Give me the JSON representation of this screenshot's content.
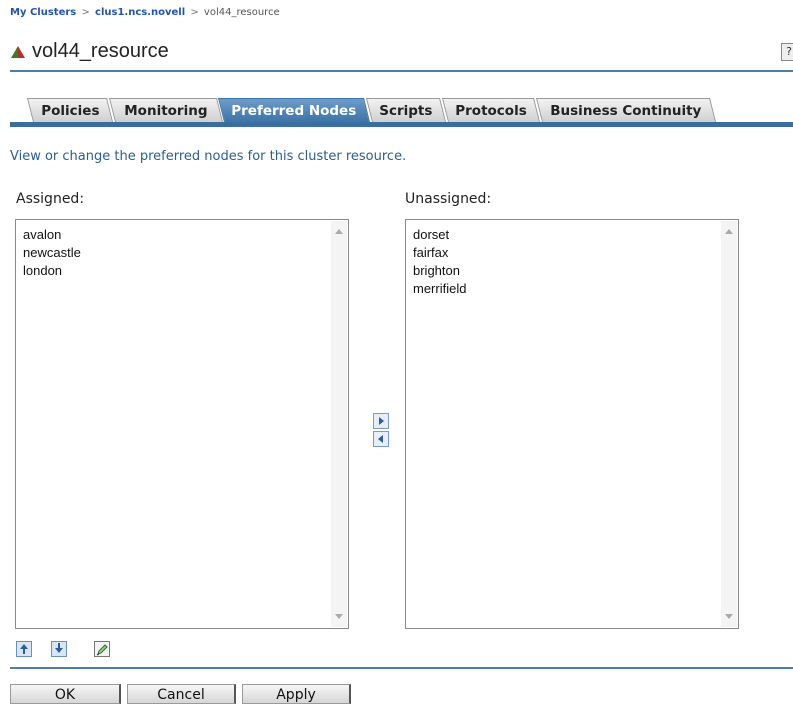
{
  "breadcrumb": {
    "items": [
      "My Clusters",
      "clus1.ncs.novell",
      "vol44_resource"
    ],
    "separator": ">"
  },
  "page": {
    "title": "vol44_resource",
    "help_label": "?",
    "icon": "cluster-resource-icon"
  },
  "tabs": [
    {
      "label": "Policies",
      "active": false
    },
    {
      "label": "Monitoring",
      "active": false
    },
    {
      "label": "Preferred Nodes",
      "active": true
    },
    {
      "label": "Scripts",
      "active": false
    },
    {
      "label": "Protocols",
      "active": false
    },
    {
      "label": "Business Continuity",
      "active": false
    }
  ],
  "description": "View or change the preferred nodes for this cluster resource.",
  "assigned": {
    "label": "Assigned:",
    "items": [
      "avalon",
      "newcastle",
      "london"
    ]
  },
  "unassigned": {
    "label": "Unassigned:",
    "items": [
      "dorset",
      "fairfax",
      "brighton",
      "merrifield"
    ]
  },
  "icons": {
    "move_right": "arrow-right-icon",
    "move_left": "arrow-left-icon",
    "move_up": "arrow-up-icon",
    "move_down": "arrow-down-icon",
    "edit": "pencil-icon"
  },
  "actions": {
    "ok": "OK",
    "cancel": "Cancel",
    "apply": "Apply"
  },
  "colors": {
    "accent": "#3a6e9f",
    "active_tab": "#4f84b8",
    "description": "#2b5e8c"
  }
}
